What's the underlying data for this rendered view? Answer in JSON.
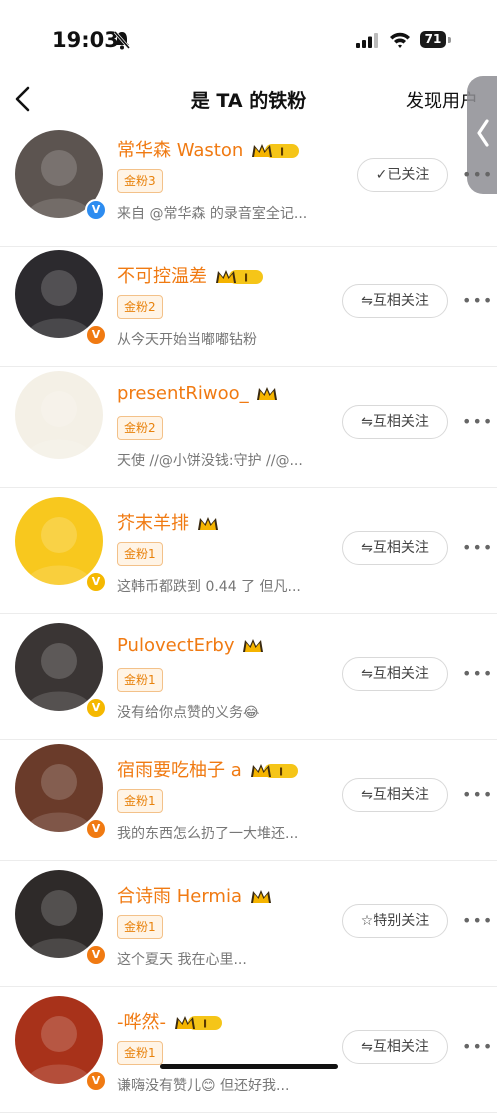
{
  "status": {
    "time": "19:03",
    "battery": "71"
  },
  "nav": {
    "title": "是 TA 的铁粉",
    "right": "发现用户"
  },
  "users": [
    {
      "name": "常华森 Waston",
      "badge": "金粉3",
      "desc": "来自 @常华森 的录音室全记...",
      "button": "✓已关注",
      "badge_color": "#2d8cf0",
      "crown": "I",
      "avatar_bg": "#5c5450"
    },
    {
      "name": "不可控温差",
      "badge": "金粉2",
      "desc": "从今天开始当嘟嘟钻粉",
      "button": "⇋互相关注",
      "badge_color": "#f07a12",
      "crown": "I",
      "avatar_bg": "#2c2a2e"
    },
    {
      "name": "presentRiwoo_",
      "badge": "金粉2",
      "desc": "天使 //@小饼没钱:守护 //@...",
      "button": "⇋互相关注",
      "badge_color": "",
      "crown": "",
      "avatar_bg": "#f4f0e6"
    },
    {
      "name": "芥末羊排",
      "badge": "金粉1",
      "desc": "这韩币都跌到 0.44 了 但凡...",
      "button": "⇋互相关注",
      "badge_color": "#f5b800",
      "crown": "",
      "avatar_bg": "#f8c81e"
    },
    {
      "name": "PulovectErby",
      "badge": "金粉1",
      "desc": "没有给你点赞的义务😂",
      "button": "⇋互相关注",
      "badge_color": "#f5b800",
      "crown": "",
      "avatar_bg": "#3a3534"
    },
    {
      "name": "宿雨要吃柚子 a",
      "badge": "金粉1",
      "desc": "我的东西怎么扔了一大堆还...",
      "button": "⇋互相关注",
      "badge_color": "#f07a12",
      "crown": "I",
      "avatar_bg": "#6a3b2a"
    },
    {
      "name": "合诗雨 Hermia",
      "badge": "金粉1",
      "desc": "这个夏天 我在心里...",
      "button": "☆特别关注",
      "badge_color": "#f07a12",
      "crown": "",
      "avatar_bg": "#2e2a29"
    },
    {
      "name": "-哗然-",
      "badge": "金粉1",
      "desc": "谦嗨没有赞儿😊 但还好我...",
      "button": "⇋互相关注",
      "badge_color": "#f07a12",
      "crown": "I",
      "avatar_bg": "#a8321a"
    }
  ]
}
